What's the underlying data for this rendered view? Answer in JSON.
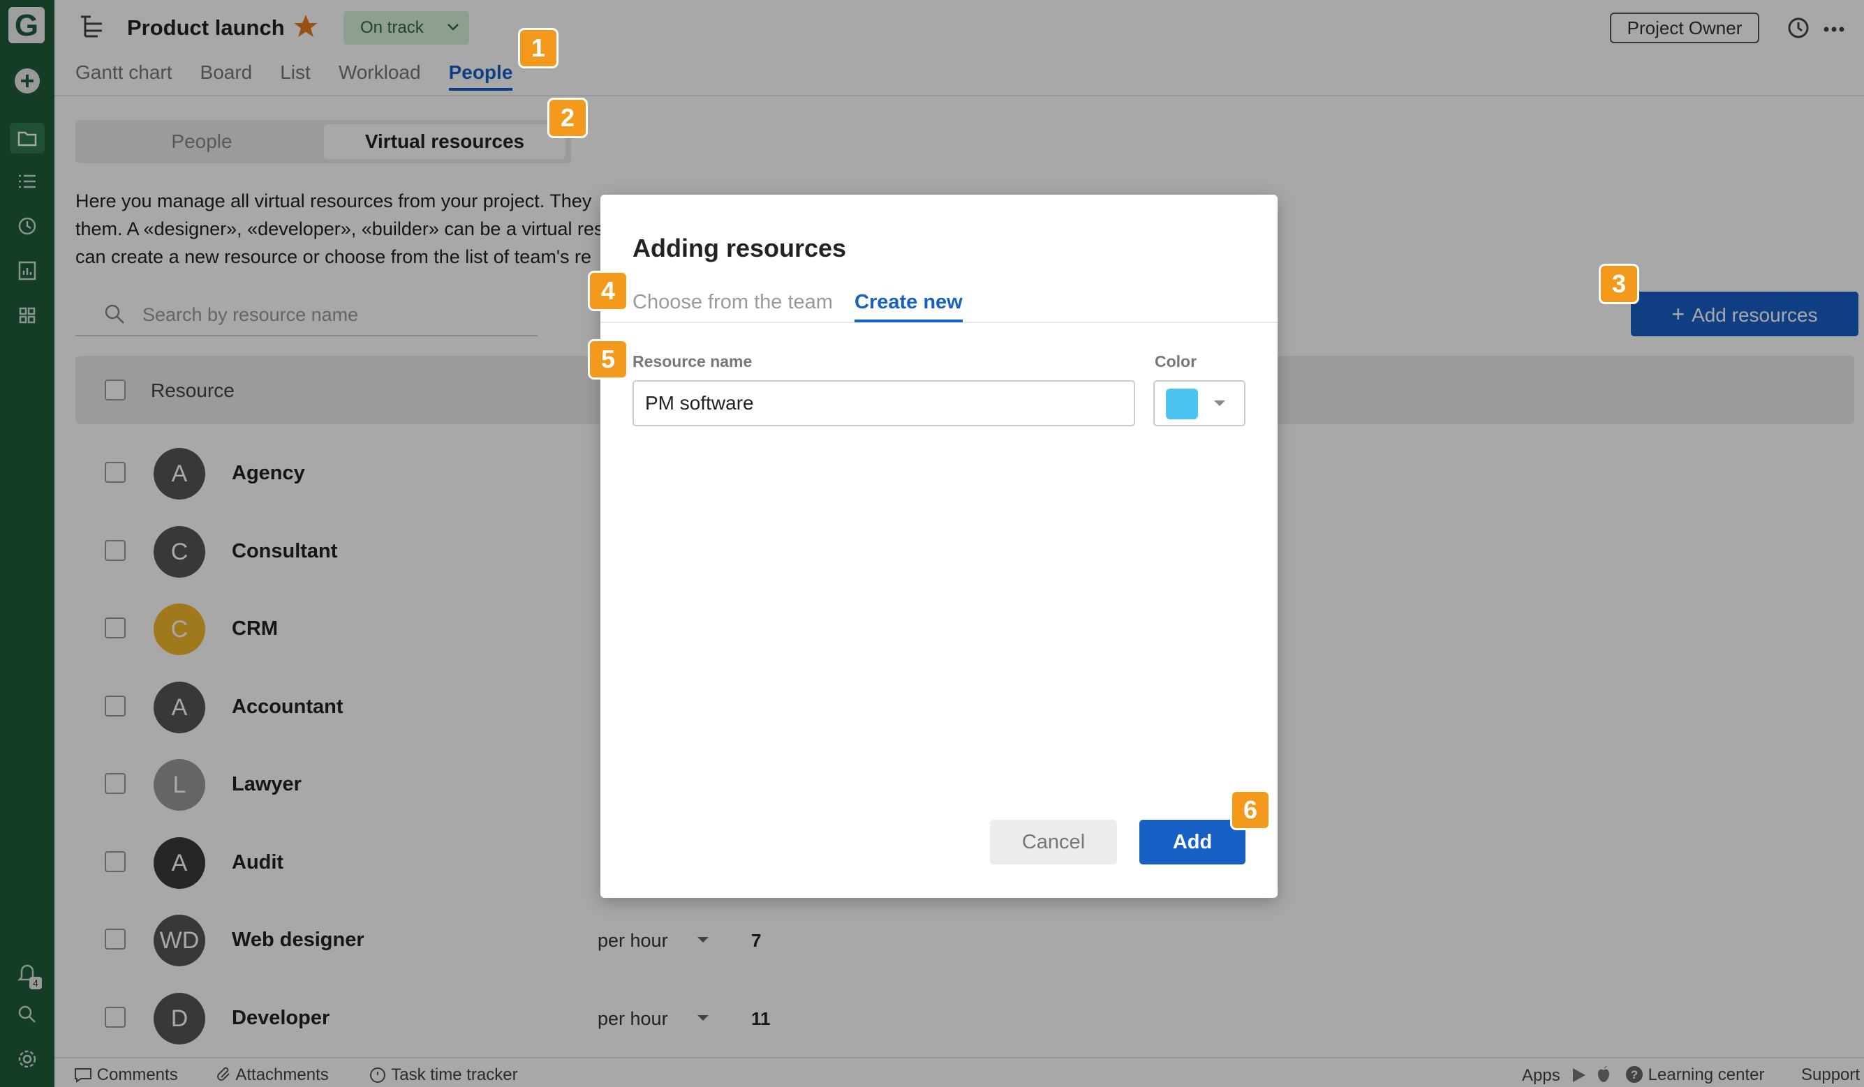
{
  "app": {
    "logo_letter": "G",
    "notifications_count": "4"
  },
  "header": {
    "title": "Product launch",
    "status": "On track",
    "owner_button": "Project Owner",
    "tabs": [
      "Gantt chart",
      "Board",
      "List",
      "Workload",
      "People"
    ],
    "active_tab": "People"
  },
  "segmented": {
    "options": [
      "People",
      "Virtual resources"
    ],
    "active": "Virtual resources"
  },
  "description": {
    "line1": "Here you manage all virtual resources from your project. They",
    "line2": "them. A «designer», «developer», «builder» can be a virtual reso",
    "line3": "can create a new resource or choose from the list of team's re"
  },
  "search": {
    "placeholder": "Search by resource name"
  },
  "add_resources_button": "Add resources",
  "table": {
    "header": "Resource",
    "rows": [
      {
        "initials": "A",
        "name": "Agency",
        "color": "#555555",
        "rate": "",
        "value": ""
      },
      {
        "initials": "C",
        "name": "Consultant",
        "color": "#555555",
        "rate": "",
        "value": ""
      },
      {
        "initials": "C",
        "name": "CRM",
        "color": "#f2b82b",
        "rate": "",
        "value": ""
      },
      {
        "initials": "A",
        "name": "Accountant",
        "color": "#555555",
        "rate": "",
        "value": ""
      },
      {
        "initials": "L",
        "name": "Lawyer",
        "color": "#9a9a9a",
        "rate": "",
        "value": ""
      },
      {
        "initials": "A",
        "name": "Audit",
        "color": "#3a3a3a",
        "rate": "",
        "value": ""
      },
      {
        "initials": "WD",
        "name": "Web designer",
        "color": "#555555",
        "rate": "per hour",
        "value": "7"
      },
      {
        "initials": "D",
        "name": "Developer",
        "color": "#555555",
        "rate": "per hour",
        "value": "11"
      }
    ]
  },
  "footer": {
    "comments": "Comments",
    "attachments": "Attachments",
    "time_tracker": "Task time tracker",
    "apps": "Apps",
    "learning_center": "Learning center",
    "support": "Support"
  },
  "modal": {
    "title": "Adding resources",
    "tabs": [
      "Choose from the team",
      "Create new"
    ],
    "active_tab": "Create new",
    "resource_name_label": "Resource name",
    "resource_name_value": "PM software",
    "color_label": "Color",
    "color_value": "#4dc3f2",
    "cancel_button": "Cancel",
    "add_button": "Add"
  },
  "callouts": [
    "1",
    "2",
    "3",
    "4",
    "5",
    "6"
  ],
  "colors": {
    "brand": "#1f5c3c",
    "accent": "#1760c5",
    "callout": "#f39a1c"
  }
}
